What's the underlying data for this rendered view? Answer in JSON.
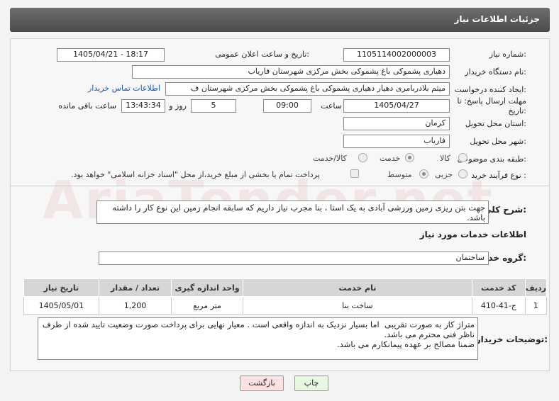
{
  "header": {
    "title": "جزئیات اطلاعات نیاز"
  },
  "form": {
    "need_number_label": "شماره نیاز:",
    "need_number": "1105114002000003",
    "announce_label": "تاریخ و ساعت اعلان عمومی:",
    "announce_value": "1405/04/21 - 18:17",
    "buyer_org_label": "نام دستگاه خریدار:",
    "buyer_org": "دهیاری پشموکی باغ پشموکی بخش مرکزی شهرستان فاریاب",
    "creator_label": "ایجاد کننده درخواست:",
    "creator": "میثم بلادربامری دهیار دهیاری پشموکی باغ پشموکی بخش مرکزی شهرستان ف",
    "contact_link": "اطلاعات تماس خریدار",
    "deadline_label_1": "مهلت ارسال پاسخ: تا",
    "deadline_label_2": "تاریخ:",
    "deadline_date": "1405/04/27",
    "time_label": "ساعت",
    "deadline_time": "09:00",
    "days_value": "5",
    "days_label": "روز و",
    "remaining_time": "13:43:34",
    "remaining_label": "ساعت باقی مانده",
    "province_label": "استان محل تحویل:",
    "province": "کرمان",
    "city_label": "شهر محل تحویل:",
    "city": "فاریاب",
    "category_label": "طبقه بندی موضوعی:",
    "category_options": [
      "کالا",
      "خدمت",
      "کالا/خدمت"
    ],
    "category_selected": "خدمت",
    "process_label": "نوع فرآیند خرید :",
    "process_options": [
      "جزیی",
      "متوسط"
    ],
    "process_selected": "متوسط",
    "payment_note": "پرداخت تمام یا بخشی از مبلغ خرید،از محل \"اسناد خزانه اسلامی\" خواهد بود."
  },
  "summary": {
    "label": "شرح کلی نیاز:",
    "text": "جهت بتن ریزی زمین ورزشی آبادی به یک استا ، بنا مجرب نیاز داریم که سابقه انجام زمین این نوع کار را داشته باشد."
  },
  "services": {
    "section_title": "اطلاعات خدمات مورد نیاز",
    "group_label": "گروه خدمت:",
    "group_value": "ساختمان",
    "columns": [
      "ردیف",
      "کد خدمت",
      "نام خدمت",
      "واحد اندازه گیری",
      "تعداد / مقدار",
      "تاریخ نیاز"
    ],
    "rows": [
      [
        "1",
        "ج-41-410",
        "ساخت بنا",
        "متر مربع",
        "1,200",
        "1405/05/01"
      ]
    ]
  },
  "notes": {
    "label": "توضیحات خریدار:",
    "text": "متراژ کار به صورت تقریبی  اما بسیار نزدیک به اندازه واقعی است . معیار نهایی برای پرداخت صورت وضعیت تایید شده از طرف ناظر فنی محترم می باشد.\nضمنا مصالح بر عهده پیمانکارم می باشد."
  },
  "buttons": {
    "print": "چاپ",
    "back": "بازگشت"
  },
  "watermark": "AriaTender.net",
  "colors": {
    "link": "#1a55b0",
    "print_btn": "#e7f7e1",
    "back_btn": "#fbe1e1"
  }
}
